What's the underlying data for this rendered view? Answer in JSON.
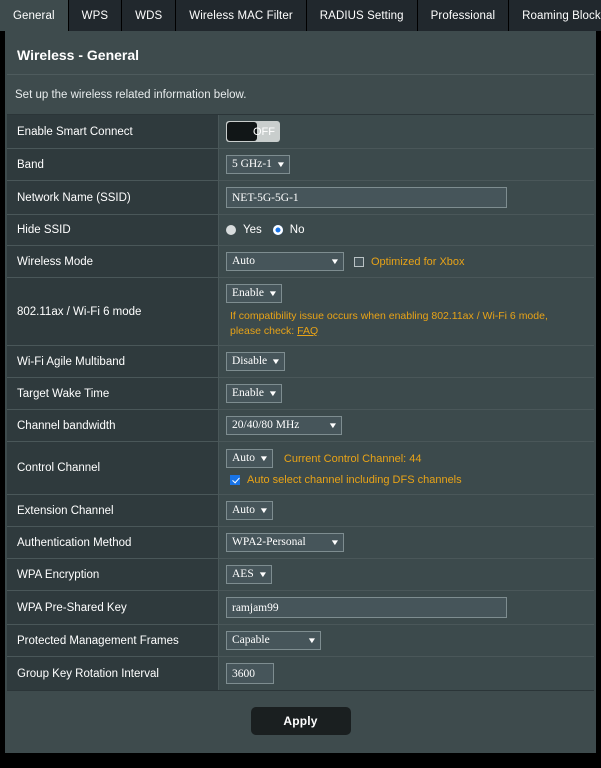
{
  "tabs": [
    {
      "label": "General",
      "active": true
    },
    {
      "label": "WPS",
      "active": false
    },
    {
      "label": "WDS",
      "active": false
    },
    {
      "label": "Wireless MAC Filter",
      "active": false
    },
    {
      "label": "RADIUS Setting",
      "active": false
    },
    {
      "label": "Professional",
      "active": false
    },
    {
      "label": "Roaming Block List",
      "active": false
    }
  ],
  "page": {
    "title": "Wireless - General",
    "description": "Set up the wireless related information below."
  },
  "rows": {
    "smart_connect": {
      "label": "Enable Smart Connect",
      "toggle_state": "OFF"
    },
    "band": {
      "label": "Band",
      "value": "5 GHz-1"
    },
    "ssid": {
      "label": "Network Name (SSID)",
      "value": "NET-5G-5G-1",
      "placeholder": ""
    },
    "hide_ssid": {
      "label": "Hide SSID",
      "options": [
        {
          "label": "Yes",
          "selected": false
        },
        {
          "label": "No",
          "selected": true
        }
      ]
    },
    "wireless_mode": {
      "label": "Wireless Mode",
      "value": "Auto",
      "xbox_label": "Optimized for Xbox",
      "xbox_checked": false
    },
    "ax_mode": {
      "label": "802.11ax / Wi-Fi 6 mode",
      "value": "Enable",
      "note_line1": "If compatibility issue occurs when enabling 802.11ax / Wi-Fi 6 mode,",
      "note_line2_prefix": "please check: ",
      "note_link": "FAQ"
    },
    "agile_multiband": {
      "label": "Wi-Fi Agile Multiband",
      "value": "Disable"
    },
    "target_wake_time": {
      "label": "Target Wake Time",
      "value": "Enable"
    },
    "channel_bandwidth": {
      "label": "Channel bandwidth",
      "value": "20/40/80 MHz"
    },
    "control_channel": {
      "label": "Control Channel",
      "value": "Auto",
      "current_text": "Current Control Channel: 44",
      "dfs_label": "Auto select channel including DFS channels",
      "dfs_checked": true
    },
    "extension_channel": {
      "label": "Extension Channel",
      "value": "Auto"
    },
    "auth_method": {
      "label": "Authentication Method",
      "value": "WPA2-Personal"
    },
    "wpa_encryption": {
      "label": "WPA Encryption",
      "value": "AES"
    },
    "wpa_psk": {
      "label": "WPA Pre-Shared Key",
      "value": "ramjam99",
      "placeholder": ""
    },
    "pmf": {
      "label": "Protected Management Frames",
      "value": "Capable"
    },
    "group_key_rotation": {
      "label": "Group Key Rotation Interval",
      "value": "3600",
      "placeholder": ""
    }
  },
  "apply": {
    "label": "Apply"
  },
  "colors": {
    "panel_bg": "#3e4b4d",
    "label_bg": "#2f3a3d",
    "value_bg": "#3c4a4c",
    "accent_amber": "#e8a317",
    "accent_blue": "#1874e8",
    "tab_inactive_bg": "#21282d",
    "apply_bg": "#1a1f20"
  },
  "icons": {
    "chevron_down": "⌵"
  }
}
